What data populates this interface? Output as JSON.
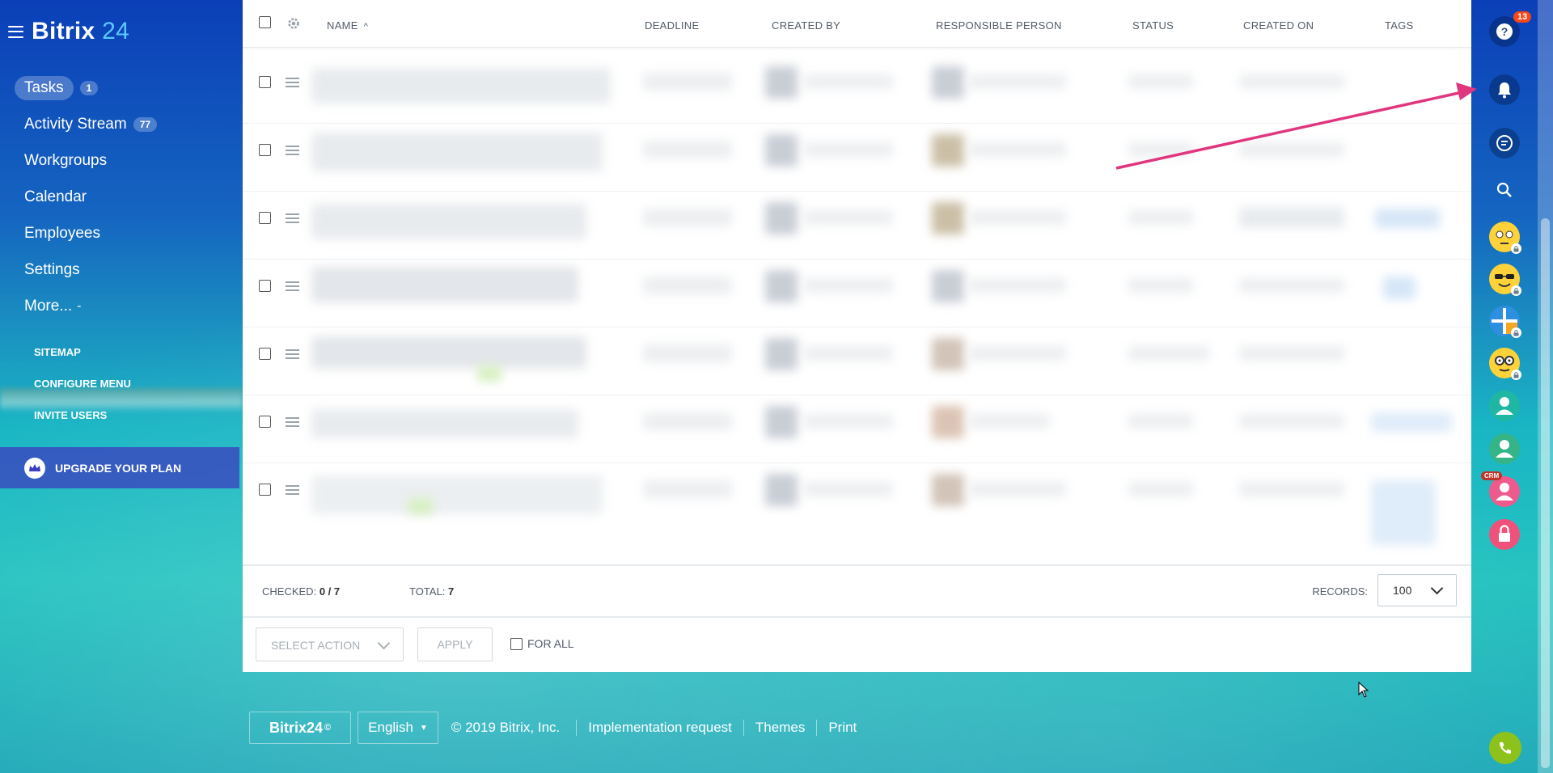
{
  "app": {
    "logo_word": "Bitrix",
    "logo_num": "24"
  },
  "left_menu": {
    "items": [
      {
        "label": "Tasks",
        "counter": "1"
      },
      {
        "label": "Activity Stream",
        "counter": "77"
      },
      {
        "label": "Workgroups"
      },
      {
        "label": "Calendar"
      },
      {
        "label": "Employees"
      },
      {
        "label": "Settings"
      },
      {
        "label": "More...",
        "suffix": "-"
      }
    ],
    "links": [
      "SITEMAP",
      "CONFIGURE MENU",
      "INVITE USERS"
    ],
    "upgrade_label": "UPGRADE YOUR PLAN"
  },
  "grid": {
    "columns": {
      "name": "NAME",
      "deadline": "DEADLINE",
      "created_by": "CREATED BY",
      "responsible": "RESPONSIBLE PERSON",
      "status": "STATUS",
      "created_on": "CREATED ON",
      "tags": "TAGS"
    },
    "sort_indicator": "^",
    "rows_count": 7,
    "footer": {
      "checked_label": "CHECKED:",
      "checked_value": "0 / 7",
      "total_label": "TOTAL:",
      "total_value": "7",
      "records_label": "RECORDS:",
      "records_value": "100"
    },
    "actions": {
      "select_action": "SELECT ACTION",
      "apply": "APPLY",
      "for_all": "FOR ALL"
    }
  },
  "footer": {
    "b24_label": "Bitrix24",
    "b24_mark": "©",
    "language": "English",
    "copyright": "© 2019 Bitrix, Inc.",
    "links": [
      "Implementation request",
      "Themes",
      "Print"
    ]
  },
  "right_bar": {
    "help_badge": "13",
    "crm_badge": "CRM"
  },
  "colors": {
    "accent": "#5cc8ff",
    "badge_red": "#f54819",
    "phone_green": "#8cc21b",
    "arrow_pink": "#e0357f"
  }
}
